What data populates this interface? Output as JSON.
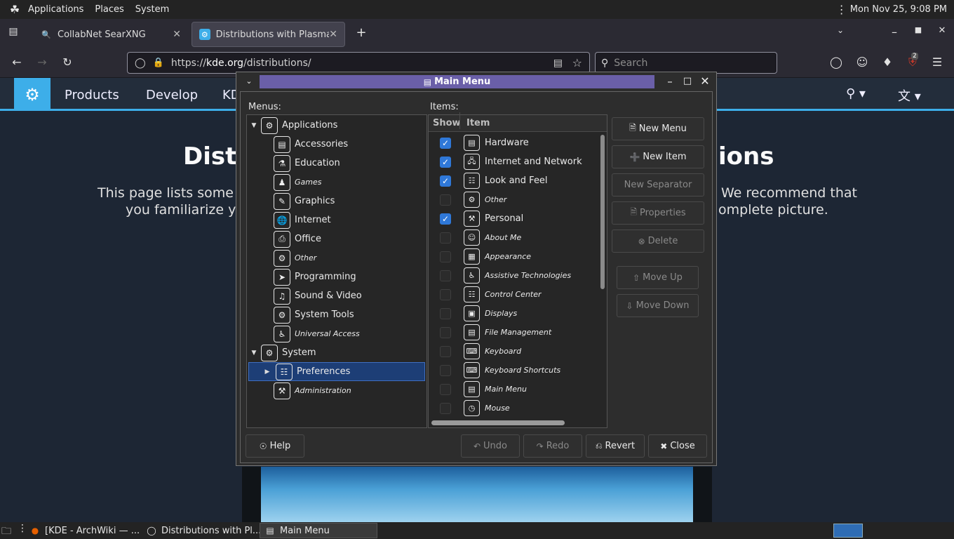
{
  "top_panel": {
    "menus": [
      "Applications",
      "Places",
      "System"
    ],
    "clock": "Mon Nov 25,  9:08 PM"
  },
  "browser": {
    "tabs": [
      {
        "label": "CollabNet SearXNG"
      },
      {
        "label": "Distributions with Plasma"
      }
    ],
    "url_prefix": "https://",
    "url_domain": "kde.org",
    "url_path": "/distributions/",
    "search_placeholder": "Search",
    "ublock_badge": "2"
  },
  "webpage": {
    "nav": [
      "Products",
      "Develop",
      "KD"
    ],
    "heading_left": "Distr",
    "heading_right": "ions",
    "para_line1_left": "This page lists some",
    "para_line1_right": "We recommend that",
    "para_line2_left": "you familiarize yo",
    "para_line2_right": "omplete picture."
  },
  "dialog": {
    "title": "Main Menu",
    "menus_label": "Menus:",
    "items_label": "Items:",
    "menus_tree": [
      {
        "label": "Applications",
        "level": 0,
        "expanded": true,
        "icon": "apps-icon"
      },
      {
        "label": "Accessories",
        "level": 1,
        "icon": "accessories-icon"
      },
      {
        "label": "Education",
        "level": 1,
        "icon": "education-icon"
      },
      {
        "label": "Games",
        "level": 1,
        "italic": true,
        "icon": "games-icon"
      },
      {
        "label": "Graphics",
        "level": 1,
        "icon": "graphics-icon"
      },
      {
        "label": "Internet",
        "level": 1,
        "icon": "internet-icon"
      },
      {
        "label": "Office",
        "level": 1,
        "icon": "office-icon"
      },
      {
        "label": "Other",
        "level": 1,
        "italic": true,
        "icon": "other-icon"
      },
      {
        "label": "Programming",
        "level": 1,
        "icon": "programming-icon"
      },
      {
        "label": "Sound & Video",
        "level": 1,
        "icon": "sound-video-icon"
      },
      {
        "label": "System Tools",
        "level": 1,
        "icon": "system-tools-icon"
      },
      {
        "label": "Universal Access",
        "level": 1,
        "italic": true,
        "icon": "universal-access-icon"
      },
      {
        "label": "System",
        "level": 0,
        "expanded": true,
        "icon": "system-icon"
      },
      {
        "label": "Preferences",
        "level": 1,
        "selected": true,
        "icon": "preferences-icon"
      },
      {
        "label": "Administration",
        "level": 1,
        "italic": true,
        "icon": "administration-icon"
      }
    ],
    "items_header": {
      "show": "Show",
      "item": "Item"
    },
    "items": [
      {
        "label": "Hardware",
        "checked": true
      },
      {
        "label": "Internet and Network",
        "checked": true
      },
      {
        "label": "Look and Feel",
        "checked": true
      },
      {
        "label": "Other",
        "checked": false,
        "italic": true
      },
      {
        "label": "Personal",
        "checked": true
      },
      {
        "label": "About Me",
        "checked": false,
        "italic": true
      },
      {
        "label": "Appearance",
        "checked": false,
        "italic": true
      },
      {
        "label": "Assistive Technologies",
        "checked": false,
        "italic": true
      },
      {
        "label": "Control Center",
        "checked": false,
        "italic": true
      },
      {
        "label": "Displays",
        "checked": false,
        "italic": true
      },
      {
        "label": "File Management",
        "checked": false,
        "italic": true
      },
      {
        "label": "Keyboard",
        "checked": false,
        "italic": true
      },
      {
        "label": "Keyboard Shortcuts",
        "checked": false,
        "italic": true
      },
      {
        "label": "Main Menu",
        "checked": false,
        "italic": true
      },
      {
        "label": "Mouse",
        "checked": false,
        "italic": true
      }
    ],
    "buttons": {
      "new_menu": "New Menu",
      "new_item": "New Item",
      "new_separator": "New Separator",
      "properties": "Properties",
      "delete": "Delete",
      "move_up": "Move Up",
      "move_down": "Move Down",
      "help": "Help",
      "undo": "Undo",
      "redo": "Redo",
      "revert": "Revert",
      "close": "Close"
    }
  },
  "taskbar": {
    "tasks": [
      "[KDE - ArchWiki — ...",
      "Distributions with Pl...",
      "Main Menu"
    ]
  }
}
